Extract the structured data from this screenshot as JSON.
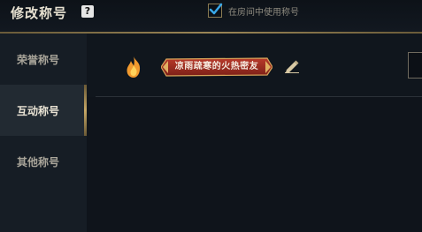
{
  "header": {
    "title": "修改称号",
    "help_icon": "?",
    "checkbox": {
      "checked": true,
      "label": "在房间中使用称号"
    }
  },
  "sidebar": {
    "items": [
      {
        "label": "荣誉称号",
        "active": false
      },
      {
        "label": "互动称号",
        "active": true
      },
      {
        "label": "其他称号",
        "active": false
      }
    ]
  },
  "main": {
    "title_item": {
      "icon": "flame-icon",
      "banner_text": "凉雨疏寒的火热密友",
      "edit_icon": "pencil-icon"
    }
  },
  "colors": {
    "accent_gold": "#c7a866",
    "banner_red": "#9a2b20",
    "flame_orange": "#f29a2e"
  }
}
